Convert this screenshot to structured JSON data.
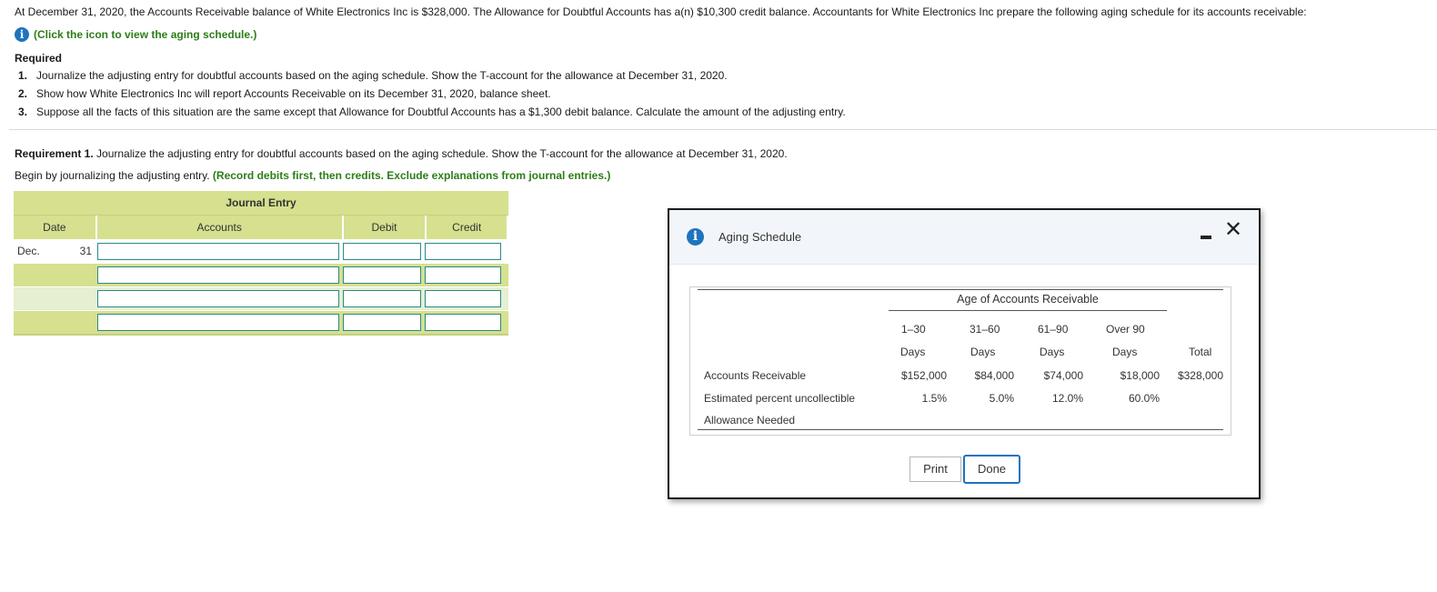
{
  "intro": "At December 31, 2020, the Accounts Receivable balance of White Electronics Inc is $328,000. The Allowance for Doubtful Accounts has a(n) $10,300 credit balance. Accountants for White Electronics Inc prepare the following aging schedule for its accounts receivable:",
  "info_link": "(Click the icon to view the aging schedule.)",
  "required": {
    "heading": "Required",
    "items": [
      {
        "num": "1.",
        "text": "Journalize the adjusting entry for doubtful accounts based on the aging schedule. Show the T-account for the allowance at December 31, 2020."
      },
      {
        "num": "2.",
        "text": "Show how White Electronics Inc will report Accounts Receivable on its December 31, 2020, balance sheet."
      },
      {
        "num": "3.",
        "text": "Suppose all the facts of this situation are the same except that Allowance for Doubtful Accounts has a $1,300 debit balance. Calculate the amount of the adjusting entry."
      }
    ]
  },
  "requirement1": {
    "label": "Requirement 1.",
    "text": " Journalize the adjusting entry for doubtful accounts based on the aging schedule. Show the T-account for the allowance at December 31, 2020."
  },
  "begin": {
    "text": "Begin by journalizing the adjusting entry. ",
    "instruction": "(Record debits first, then credits. Exclude explanations from journal entries.)"
  },
  "journal": {
    "title": "Journal Entry",
    "headers": {
      "date": "Date",
      "accounts": "Accounts",
      "debit": "Debit",
      "credit": "Credit"
    },
    "date_month": "Dec.",
    "date_day": "31"
  },
  "modal": {
    "title": "Aging Schedule",
    "age_heading": "Age of Accounts Receivable",
    "col_top": [
      "1–30",
      "31–60",
      "61–90",
      "Over 90",
      ""
    ],
    "col_bottom": [
      "Days",
      "Days",
      "Days",
      "Days",
      "Total"
    ],
    "rows": [
      {
        "label": "Accounts Receivable",
        "values": [
          "$152,000",
          "$84,000",
          "$74,000",
          "$18,000",
          "$328,000"
        ]
      },
      {
        "label": "Estimated percent uncollectible",
        "values": [
          "1.5%",
          "5.0%",
          "12.0%",
          "60.0%",
          ""
        ]
      },
      {
        "label": "Allowance Needed",
        "values": [
          "",
          "",
          "",
          "",
          ""
        ]
      }
    ],
    "print_label": "Print",
    "done_label": "Done",
    "close_symbol": "✕"
  },
  "colors": {
    "accent": "#1e73be",
    "green": "#2d7d18",
    "table_header": "#d6e08f"
  },
  "icons": [
    "info-icon",
    "minimize-icon",
    "close-icon"
  ]
}
